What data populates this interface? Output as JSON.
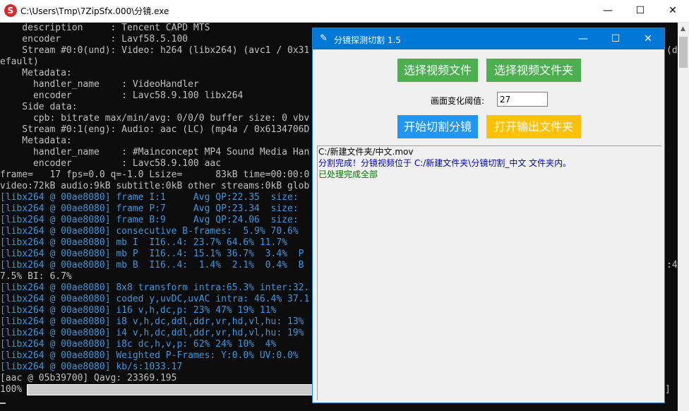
{
  "console_window": {
    "icon_glyph": "S",
    "title": "C:\\Users\\Tmp\\7ZipSfx.000\\分镜.exe",
    "min_glyph": "—",
    "max_glyph": "☐",
    "close_glyph": "✕"
  },
  "console": {
    "lines": [
      {
        "text": "    description     : Tencent CAPD MTS",
        "color": "#c0c0c0"
      },
      {
        "text": "    encoder         : Lavf58.5.100",
        "color": "#c0c0c0"
      },
      {
        "text": "    Stream #0:0(und): Video: h264 (libx264) (avc1 / 0x31",
        "color": "#c0c0c0"
      },
      {
        "text": "efault)",
        "color": "#c0c0c0"
      },
      {
        "text": "    Metadata:",
        "color": "#c0c0c0"
      },
      {
        "text": "      handler_name    : VideoHandler",
        "color": "#c0c0c0"
      },
      {
        "text": "      encoder         : Lavc58.9.100 libx264",
        "color": "#c0c0c0"
      },
      {
        "text": "    Side data:",
        "color": "#c0c0c0"
      },
      {
        "text": "      cpb: bitrate max/min/avg: 0/0/0 buffer size: 0 vbv",
        "color": "#c0c0c0"
      },
      {
        "text": "    Stream #0:1(eng): Audio: aac (LC) (mp4a / 0x6134706D",
        "color": "#c0c0c0"
      },
      {
        "text": "    Metadata:",
        "color": "#c0c0c0"
      },
      {
        "text": "      handler_name    : #Mainconcept MP4 Sound Media Han",
        "color": "#c0c0c0"
      },
      {
        "text": "      encoder         : Lavc58.9.100 aac",
        "color": "#c0c0c0"
      },
      {
        "text": "frame=   17 fps=0.0 q=-1.0 Lsize=      83kB time=00:00:0",
        "color": "#c0c0c0"
      },
      {
        "text": "video:72kB audio:9kB subtitle:0kB other streams:0kB glob",
        "color": "#c0c0c0"
      },
      {
        "text": "[libx264 @ 00ae8080] frame I:1     Avg QP:22.35  size: ",
        "color": "#3a96dd"
      },
      {
        "text": "[libx264 @ 00ae8080] frame P:7     Avg QP:23.34  size: ",
        "color": "#3a96dd"
      },
      {
        "text": "[libx264 @ 00ae8080] frame B:9     Avg QP:24.06  size: ",
        "color": "#3a96dd"
      },
      {
        "text": "[libx264 @ 00ae8080] consecutive B-frames:  5.9% 70.6% ",
        "color": "#3a96dd"
      },
      {
        "text": "[libx264 @ 00ae8080] mb I  I16..4: 23.7% 64.6% 11.7%",
        "color": "#3a96dd"
      },
      {
        "text": "[libx264 @ 00ae8080] mb P  I16..4: 15.1% 36.7%  3.4%  P",
        "color": "#3a96dd"
      },
      {
        "text": "[libx264 @ 00ae8080] mb B  I16..4:  1.4%  2.1%  0.4%  B",
        "color": "#3a96dd"
      },
      {
        "text": "7.5% BI: 6.7%",
        "color": "#c0c0c0"
      },
      {
        "text": "[libx264 @ 00ae8080] 8x8 transform intra:65.3% inter:32.",
        "color": "#3a96dd"
      },
      {
        "text": "[libx264 @ 00ae8080] coded y,uvDC,uvAC intra: 46.4% 37.1",
        "color": "#3a96dd"
      },
      {
        "text": "[libx264 @ 00ae8080] i16 v,h,dc,p: 23% 47% 19% 11%",
        "color": "#3a96dd"
      },
      {
        "text": "[libx264 @ 00ae8080] i8 v,h,dc,ddl,ddr,vr,hd,vl,hu: 13%",
        "color": "#3a96dd"
      },
      {
        "text": "[libx264 @ 00ae8080] i4 v,h,dc,ddl,ddr,vr,hd,vl,hu: 19%",
        "color": "#3a96dd"
      },
      {
        "text": "[libx264 @ 00ae8080] i8c dc,h,v,p: 62% 24% 10%  4%",
        "color": "#3a96dd"
      },
      {
        "text": "[libx264 @ 00ae8080] Weighted P-Frames: Y:0.0% UV:0.0%",
        "color": "#3a96dd"
      },
      {
        "text": "[libx264 @ 00ae8080] kb/s:1033.17",
        "color": "#3a96dd"
      },
      {
        "text": "[aac @ 05b39700] Qavg: 23369.195",
        "color": "#c0c0c0"
      }
    ],
    "right_fragments": [
      {
        "text": "(d",
        "line": 2
      },
      {
        "text": ":4",
        "line": 21
      }
    ],
    "progress": {
      "percent_label": "100%",
      "value": 1.0,
      "right_bracket": "]"
    }
  },
  "tool_window": {
    "icon": "feather-icon",
    "icon_glyph": "✎",
    "title": "分镜探测切割 1.5",
    "min_glyph": "—",
    "max_glyph": "☐",
    "close_glyph": "✕",
    "buttons": {
      "select_video_file": "选择视频文件",
      "select_video_folder": "选择视频文件夹",
      "start_cut": "开始切割分镜",
      "open_output_folder": "打开输出文件夹"
    },
    "threshold_label": "画面变化阈值:",
    "threshold_value": "27",
    "log": [
      {
        "text": "C:/新建文件夹/中文.mov",
        "color": "#000000"
      },
      {
        "text": "分割完成！分镜视频位于  C:/新建文件夹\\分镜切割_中文  文件夹内。",
        "color": "#0000cc"
      },
      {
        "text": "已处理完成全部",
        "color": "#007700"
      }
    ]
  },
  "colors": {
    "green_button": "#4caf50",
    "blue_button": "#2196f3",
    "yellow_button": "#ffc107",
    "title_bar_active": "#0078d7",
    "console_bg": "#0c0c0c",
    "console_text": "#c0c0c0",
    "console_blue": "#3a96dd"
  }
}
